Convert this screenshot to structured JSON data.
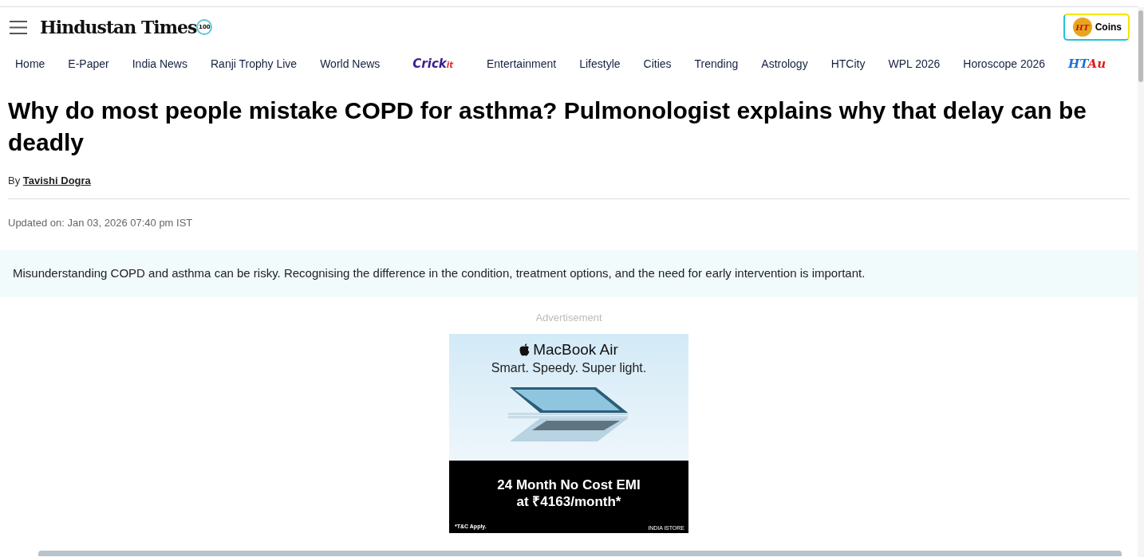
{
  "header": {
    "logo": {
      "name": "Hindustan Times",
      "badge": "100"
    },
    "coins_button": {
      "coin": "HT",
      "label": "Coins"
    }
  },
  "nav": [
    {
      "kind": "text",
      "label": "Home"
    },
    {
      "kind": "text",
      "label": "E-Paper"
    },
    {
      "kind": "text",
      "label": "India News"
    },
    {
      "kind": "text",
      "label": "Ranji Trophy Live"
    },
    {
      "kind": "text",
      "label": "World News"
    },
    {
      "kind": "crick",
      "label": "Crick",
      "accent": "it"
    },
    {
      "kind": "text",
      "label": "Entertainment"
    },
    {
      "kind": "text",
      "label": "Lifestyle"
    },
    {
      "kind": "text",
      "label": "Cities"
    },
    {
      "kind": "text",
      "label": "Trending"
    },
    {
      "kind": "text",
      "label": "Astrology"
    },
    {
      "kind": "text",
      "label": "HTCity"
    },
    {
      "kind": "text",
      "label": "WPL 2026"
    },
    {
      "kind": "text",
      "label": "Horoscope 2026"
    },
    {
      "kind": "htauto",
      "label": "HT",
      "accent": "Au"
    }
  ],
  "article": {
    "headline": "Why do most people mistake COPD for asthma? Pulmonologist explains why that delay can be deadly",
    "byline_prefix": "By",
    "author": "Tavishi Dogra",
    "updated": "Updated on: Jan 03, 2026 07:40 pm IST",
    "summary": "Misunderstanding COPD and asthma can be risky. Recognising the difference in the condition, treatment options, and the need for early intervention is important."
  },
  "advertisement": {
    "label": "Advertisement",
    "product": "MacBook Air",
    "tagline": "Smart. Speedy. Super light.",
    "offer_line_1": "24 Month No Cost EMI",
    "offer_line_2": "at ₹4163/month*",
    "terms": "*T&C Apply.",
    "store": "INDIA iSTORE"
  }
}
